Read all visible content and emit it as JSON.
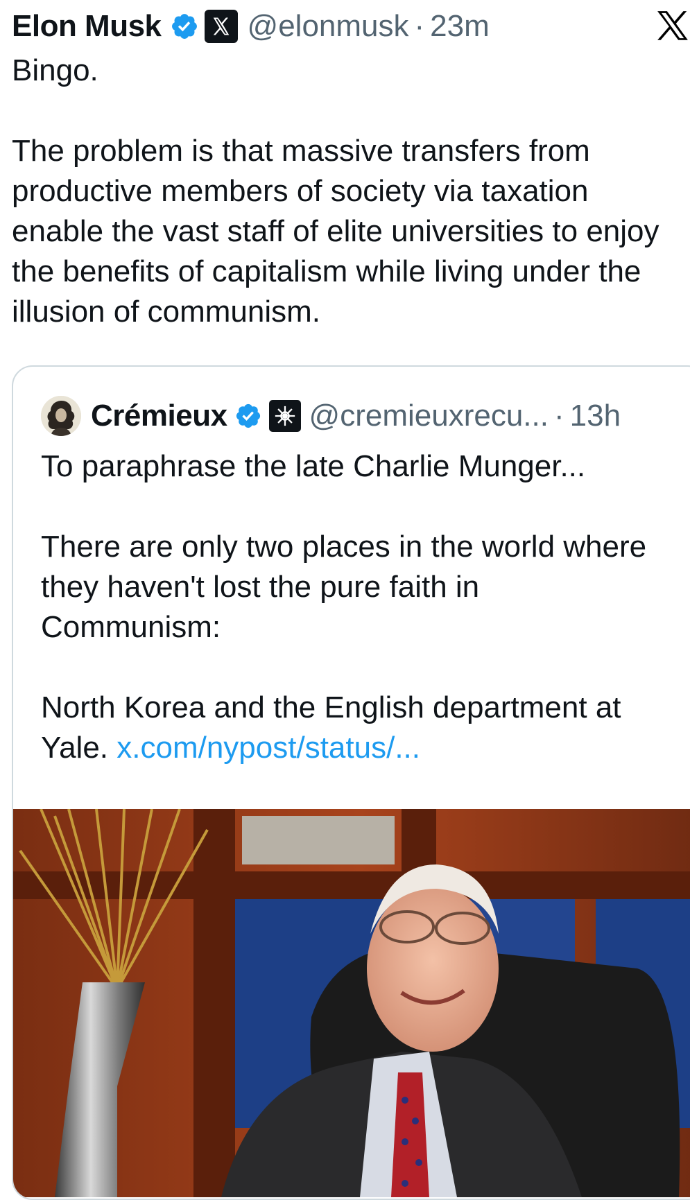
{
  "tweet": {
    "author_name": "Elon Musk",
    "handle": "@elonmusk",
    "separator": "·",
    "time": "23m",
    "paragraphs": [
      "Bingo.",
      "The problem is that massive transfers from productive members of society via taxation enable the vast staff of elite universities to enjoy the benefits of capitalism while living under the illusion of communism."
    ]
  },
  "quoted": {
    "author_name": "Crémieux",
    "handle": "@cremieuxrecu...",
    "separator": "·",
    "time": "13h",
    "paragraphs": [
      "To paraphrase the late Charlie Munger...",
      "There are only two places in the world where they haven't lost the pure faith in Communism:",
      "North Korea and the English department at Yale."
    ],
    "link_text": "x.com/nypost/status/..."
  },
  "icons": {
    "verified": "verified-badge-icon",
    "affiliate_x": "x-affiliate-icon",
    "affiliate_cremieux": "cremieux-affiliate-icon",
    "platform_logo": "x-logo-icon"
  },
  "colors": {
    "text": "#0f1419",
    "muted": "#536471",
    "link": "#1d9bf0",
    "verified": "#1d9bf0",
    "border": "#cfd9de"
  }
}
